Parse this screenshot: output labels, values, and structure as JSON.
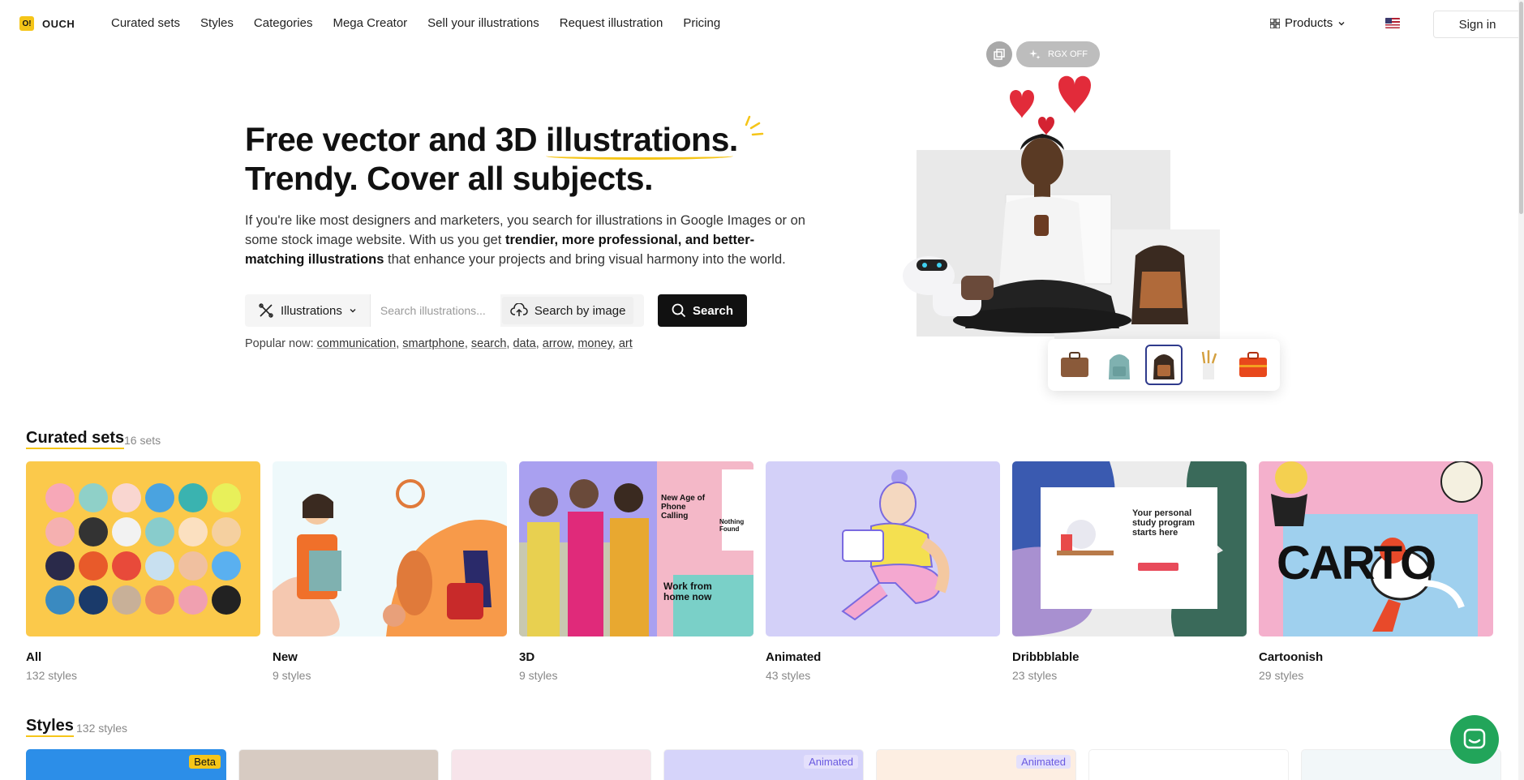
{
  "header": {
    "logo_mark": "O!",
    "logo_text": "OUCH",
    "nav": [
      "Curated sets",
      "Styles",
      "Categories",
      "Mega Creator",
      "Sell your illustrations",
      "Request illustration",
      "Pricing"
    ],
    "products_label": "Products",
    "signin_label": "Sign in"
  },
  "hero": {
    "title_line1_a": "Free vector and 3D ",
    "title_line1_b": "illustrations.",
    "title_line2": "Trendy. Cover all subjects.",
    "desc_a": "If you're like most designers and marketers, you search for illustrations in Google Images or on some stock image website. With us you get ",
    "desc_bold": "trendier, more professional, and better-matching illustrations",
    "desc_b": " that enhance your projects and bring visual harmony into the world."
  },
  "search": {
    "type_label": "Illustrations",
    "placeholder": "Search illustrations...",
    "by_image_label": "Search by image",
    "button_label": "Search",
    "popular_label": "Popular now:",
    "popular": [
      "communication",
      "smartphone",
      "search",
      "data",
      "arrow",
      "money",
      "art"
    ]
  },
  "art_controls": {
    "rgx_label": "RGX OFF"
  },
  "curated": {
    "title": "Curated sets",
    "count": "16 sets",
    "cards": [
      {
        "name": "All",
        "count": "132 styles"
      },
      {
        "name": "New",
        "count": "9 styles"
      },
      {
        "name": "3D",
        "count": "9 styles"
      },
      {
        "name": "Animated",
        "count": "43 styles"
      },
      {
        "name": "Dribbblable",
        "count": "23 styles"
      },
      {
        "name": "Cartoonish",
        "count": "29 styles"
      }
    ],
    "card3d_text": {
      "headline": "New Age of Phone Calling",
      "nf": "Nothing Found",
      "wfh": "Work from home now"
    },
    "dribbble_text": {
      "headline": "Your personal study program starts here"
    },
    "carto_text": "CARTO"
  },
  "styles": {
    "title": "Styles",
    "count": "132 styles",
    "badges": [
      "Beta",
      "",
      "",
      "Animated",
      "Animated",
      "",
      ""
    ]
  },
  "colors": {
    "accent": "#f5c518",
    "chat": "#22a55a",
    "search_btn": "#111111"
  }
}
